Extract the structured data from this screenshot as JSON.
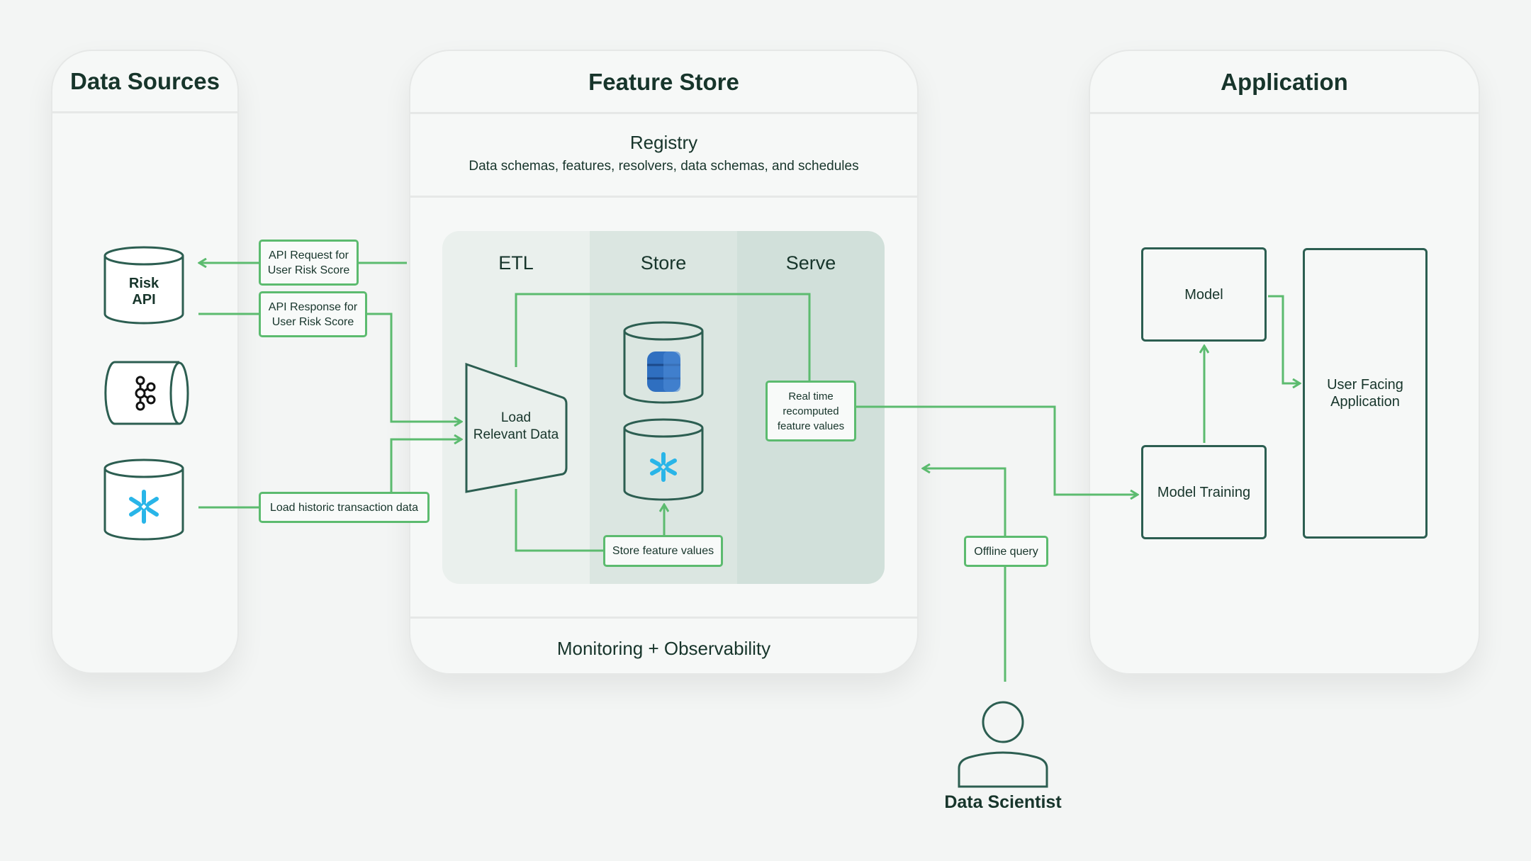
{
  "colors": {
    "accent_green": "#5cbb6f",
    "outline_dark": "#2c5e51",
    "text_dark": "#17352b",
    "dynamodb_blue": "#2f6fc0",
    "snowflake_blue": "#29b5e8"
  },
  "data_sources": {
    "title": "Data Sources",
    "items": [
      {
        "name": "Risk API",
        "label_line1": "Risk",
        "label_line2": "API",
        "icon": "database-cylinder"
      },
      {
        "name": "Kafka",
        "icon": "kafka-icon"
      },
      {
        "name": "Snowflake",
        "icon": "snowflake-icon"
      }
    ]
  },
  "feature_store": {
    "title": "Feature Store",
    "registry": {
      "title": "Registry",
      "subtitle": "Data schemas, features, resolvers, data schemas, and schedules"
    },
    "pipeline": {
      "columns": [
        "ETL",
        "Store",
        "Serve"
      ],
      "etl_node": {
        "line1": "Load",
        "line2": "Relevant Data"
      },
      "store_items": [
        {
          "name": "DynamoDB",
          "icon": "dynamodb-icon"
        },
        {
          "name": "Snowflake",
          "icon": "snowflake-icon"
        }
      ],
      "store_label": "Store feature values",
      "serve_label": {
        "line1": "Real time",
        "line2": "recomputed",
        "line3": "feature values"
      }
    },
    "monitoring": "Monitoring + Observability"
  },
  "edge_labels": {
    "api_request": {
      "line1": "API Request for",
      "line2": "User Risk Score"
    },
    "api_response": {
      "line1": "API Response for",
      "line2": "User Risk Score"
    },
    "historic": "Load historic transaction data",
    "offline_query": "Offline query"
  },
  "application": {
    "title": "Application",
    "model": "Model",
    "model_training": "Model Training",
    "user_facing": {
      "line1": "User Facing",
      "line2": "Application"
    }
  },
  "actor": {
    "label": "Data Scientist",
    "icon": "person-icon"
  }
}
